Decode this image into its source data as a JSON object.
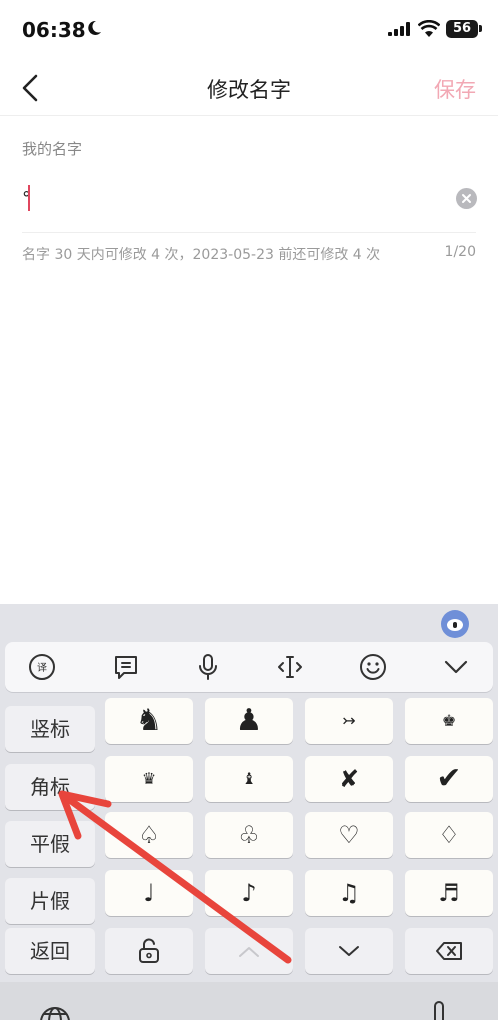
{
  "status": {
    "time": "06:38",
    "battery": "56"
  },
  "nav": {
    "title": "修改名字",
    "save": "保存"
  },
  "form": {
    "label": "我的名字",
    "value": "°",
    "hint": "名字 30 天内可修改 4 次，2023-05-23 前还可修改 4 次",
    "counter": "1/20"
  },
  "keyboard": {
    "side_keys": [
      "竖标",
      "角标",
      "平假",
      "片假",
      "返回"
    ],
    "symbols": [
      [
        "♞",
        "♟",
        "↣",
        "♚"
      ],
      [
        "♛",
        "♝",
        "✘",
        "✔"
      ],
      [
        "♤",
        "♧",
        "♡",
        "♢"
      ],
      [
        "♩",
        "♪",
        "♫",
        "♬"
      ]
    ],
    "toolbar_icons": [
      "translate-icon",
      "text-panel-icon",
      "microphone-icon",
      "cursor-move-icon",
      "emoji-icon",
      "collapse-keyboard-icon"
    ]
  },
  "annotation": {
    "arrow_color": "#e8453c"
  }
}
